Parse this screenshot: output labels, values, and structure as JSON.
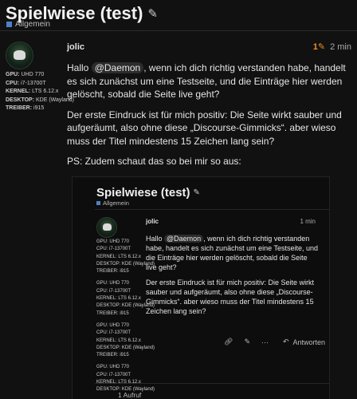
{
  "topic": {
    "title": "Spielwiese (test)",
    "edit_icon": "pencil-icon",
    "category": "Allgemein",
    "category_color": "#4f81c7"
  },
  "post": {
    "username": "jolic",
    "edit_count": "1",
    "time": "2 min",
    "flair": [
      {
        "key": "GPU:",
        "value": "UHD 770"
      },
      {
        "key": "CPU:",
        "value": "i7-13700T"
      },
      {
        "key": "KERNEL:",
        "value": "LTS 6.12.x"
      },
      {
        "key": "DESKTOP:",
        "value": "KDE (Wayland)"
      },
      {
        "key": "TREIBER:",
        "value": "i915"
      }
    ],
    "paragraph1_before": "Hallo ",
    "mention": "@Daemon",
    "paragraph1_after": ", wenn ich dich richtig verstanden habe, handelt es sich zunächst um eine Testseite, und die Einträge hier werden gelöscht, sobald die Seite live geht?",
    "paragraph2": "Der erste Eindruck ist für mich positiv: Die Seite wirkt sauber und aufgeräumt, also ohne diese „Discourse-Gimmicks“. aber wieso muss der Titel mindestens 15 Zeichen lang sein?",
    "paragraph3": "PS: Zudem schaut das so bei mir so aus:"
  },
  "screenshot": {
    "title": "Spielwiese (test)",
    "category": "Allgemein",
    "username": "jolic",
    "time": "1 min",
    "flair_blocks": [
      [
        {
          "key": "GPU:",
          "value": "UHD 770"
        },
        {
          "key": "CPU:",
          "value": "i7-13700T"
        },
        {
          "key": "KERNEL:",
          "value": "LTS 6.12.x"
        },
        {
          "key": "DESKTOP:",
          "value": "KDE (Wayland)"
        },
        {
          "key": "TREIBER:",
          "value": "i915"
        }
      ],
      [
        {
          "key": "GPU:",
          "value": "UHD 770"
        },
        {
          "key": "CPU:",
          "value": "i7-13700T"
        },
        {
          "key": "KERNEL:",
          "value": "LTS 6.12.x"
        },
        {
          "key": "DESKTOP:",
          "value": "KDE (Wayland)"
        },
        {
          "key": "TREIBER:",
          "value": "i915"
        }
      ],
      [
        {
          "key": "GPU:",
          "value": "UHD 770"
        },
        {
          "key": "CPU:",
          "value": "i7-13700T"
        },
        {
          "key": "KERNEL:",
          "value": "LTS 6.12.x"
        },
        {
          "key": "DESKTOP:",
          "value": "KDE (Wayland)"
        },
        {
          "key": "TREIBER:",
          "value": "i915"
        }
      ],
      [
        {
          "key": "GPU:",
          "value": "UHD 770"
        },
        {
          "key": "CPU:",
          "value": "i7-13700T"
        },
        {
          "key": "KERNEL:",
          "value": "LTS 6.12.x"
        },
        {
          "key": "DESKTOP:",
          "value": "KDE (Wayland)"
        }
      ]
    ],
    "paragraph1_before": "Hallo ",
    "mention": "@Daemon",
    "paragraph1_after": ", wenn ich dich richtig verstanden habe, handelt es sich zunächst um eine Testseite, und die Einträge hier werden gelöscht, sobald die Seite live geht?",
    "paragraph2": "Der erste Eindruck ist für mich positiv: Die Seite wirkt sauber und aufgeräumt, also ohne diese „Discourse-Gimmicks“. aber wieso muss der Titel mindestens 15 Zeichen lang sein?",
    "reply_label": "Antworten",
    "views": "1 Aufruf"
  }
}
